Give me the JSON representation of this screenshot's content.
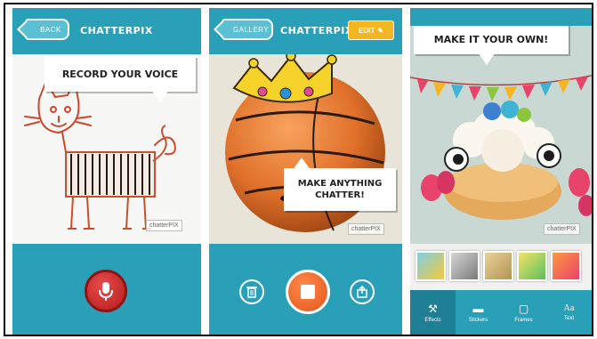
{
  "screens": [
    {
      "back_button": "BACK",
      "title": "CHATTERPIX",
      "bubble": "RECORD YOUR VOICE",
      "watermark": "chatterPIX",
      "record_button_icon": "microphone-icon"
    },
    {
      "back_button": "GALLERY",
      "title": "CHATTERPIX",
      "edit_button": "EDIT",
      "bubble": "MAKE ANYTHING CHATTER!",
      "watermark": "chatterPIX",
      "icons": [
        "trash-icon",
        "stop-icon",
        "share-icon"
      ]
    },
    {
      "bubble": "MAKE IT YOUR OWN!",
      "watermark": "chatterPIX",
      "toolbar": [
        {
          "label": "Effects",
          "icon": "wand-icon"
        },
        {
          "label": "Stickers",
          "icon": "hat-icon"
        },
        {
          "label": "Frames",
          "icon": "frame-icon"
        },
        {
          "label": "Text",
          "icon": "text-icon"
        }
      ]
    }
  ],
  "colors": {
    "brand_teal": "#2a9fb8",
    "light_teal": "#5cc0d4",
    "record_red": "#c62828",
    "stop_orange": "#f26a2e",
    "edit_yellow": "#f5b623"
  }
}
